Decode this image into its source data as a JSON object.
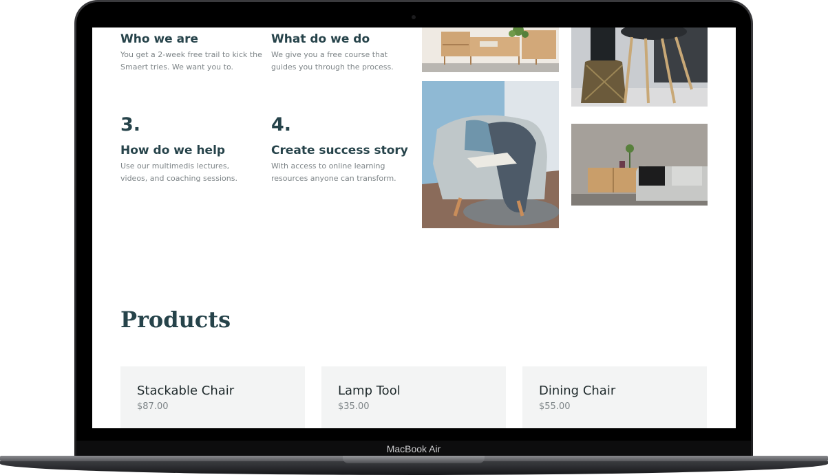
{
  "device": {
    "label": "MacBook Air"
  },
  "steps": [
    {
      "number": "",
      "title": "Who we are",
      "text": "You get a 2-week free trail to kick the Smaert tries. We want you to."
    },
    {
      "number": "",
      "title": "What do we do",
      "text": "We give you a free course that guides you through the process."
    },
    {
      "number": "3.",
      "title": "How do we help",
      "text": "Use our multimedis lectures, videos, and coaching sessions."
    },
    {
      "number": "4.",
      "title": "Create success story",
      "text": "With access to online learning resources anyone can transform."
    }
  ],
  "gallery": [
    {
      "name": "sideboard-photo"
    },
    {
      "name": "stool-photo"
    },
    {
      "name": "armchair-photo"
    },
    {
      "name": "living-room-photo"
    }
  ],
  "products": {
    "title": "Products",
    "items": [
      {
        "name": "Stackable Chair",
        "price": "$87.00"
      },
      {
        "name": "Lamp Tool",
        "price": "$35.00"
      },
      {
        "name": "Dining Chair",
        "price": "$55.00"
      }
    ]
  }
}
